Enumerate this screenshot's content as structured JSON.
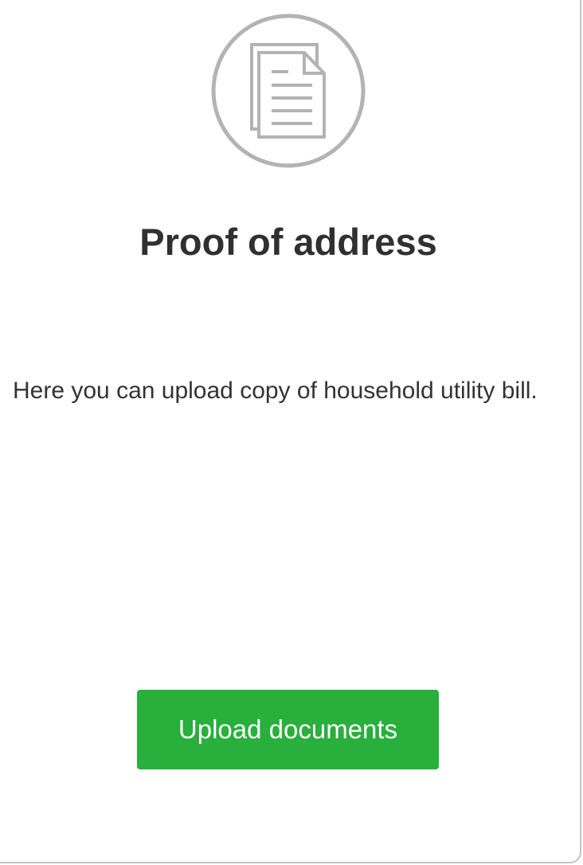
{
  "card": {
    "icon": "document-copies-icon",
    "title": "Proof of address",
    "description": "Here you can upload copy of household utility bill.",
    "upload_button_label": "Upload documents"
  },
  "colors": {
    "accent": "#28af3c",
    "icon_gray": "#b3b3b3",
    "text": "#303030",
    "border": "#c4c4c4"
  }
}
